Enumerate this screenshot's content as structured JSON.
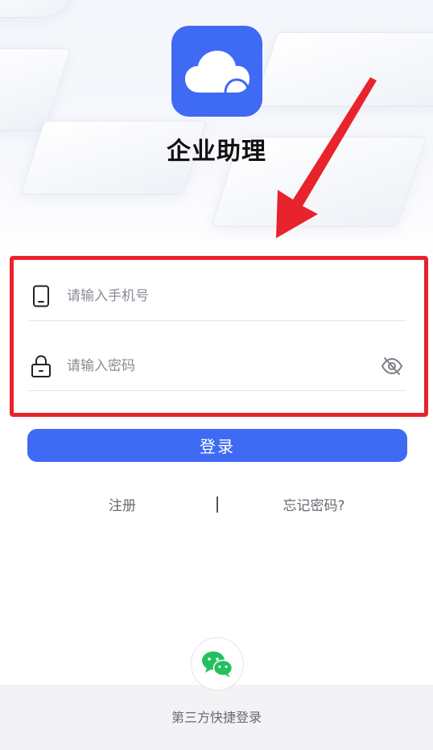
{
  "app": {
    "title": "企业助理"
  },
  "login_form": {
    "phone_placeholder": "请输入手机号",
    "password_placeholder": "请输入密码",
    "login_button": "登录"
  },
  "links": {
    "register": "注册",
    "forgot_password": "忘记密码?"
  },
  "third_party": {
    "label": "第三方快捷登录",
    "provider_icon": "wechat-icon"
  },
  "colors": {
    "brand": "#3f6af4",
    "highlight": "#e8232c",
    "wechat": "#22c15e"
  }
}
